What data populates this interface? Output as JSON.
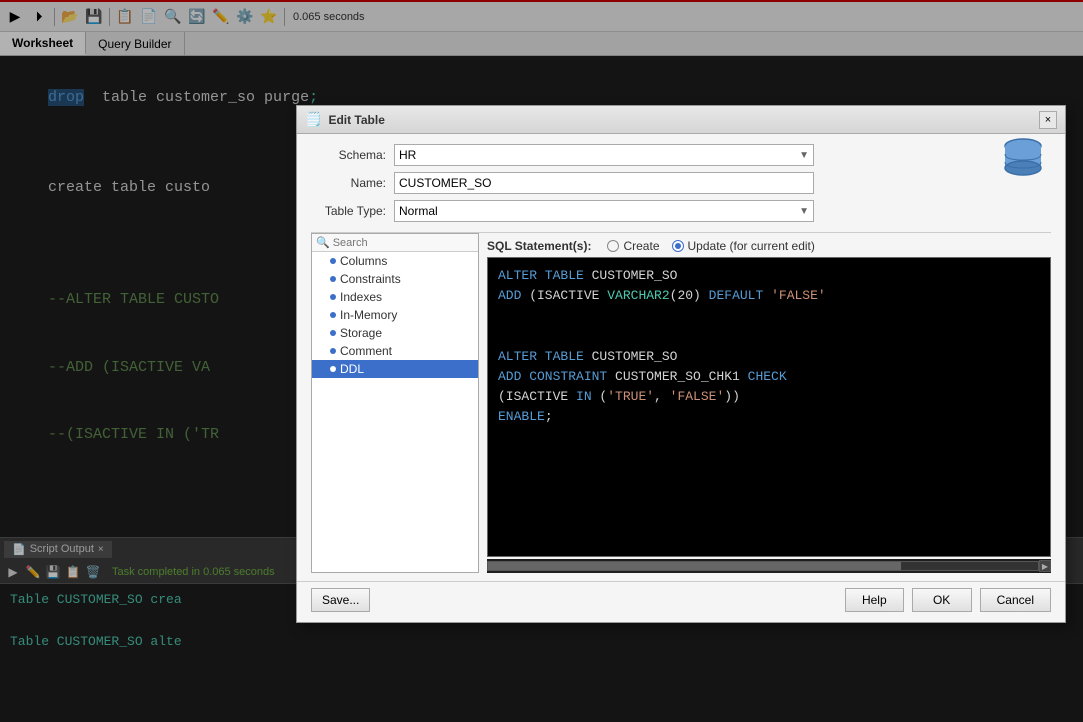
{
  "toolbar": {
    "timer": "0.065 seconds"
  },
  "tabs": [
    {
      "label": "Worksheet",
      "active": true
    },
    {
      "label": "Query Builder",
      "active": false
    }
  ],
  "editor": {
    "lines": [
      "drop  table customer_so purge;",
      "",
      "create table custo"
    ],
    "lines2": [
      "--ALTER TABLE CUSTO",
      "--ADD (ISACTIVE VA",
      "--(ISACTIVE IN ('TR"
    ]
  },
  "bottom_panel": {
    "tab_label": "Script Output",
    "status_text": "Task completed in 0.065 seconds",
    "output_lines": [
      "Table CUSTOMER_SO crea",
      "",
      "Table CUSTOMER_SO alte"
    ]
  },
  "dialog": {
    "title": "Edit Table",
    "close_label": "×",
    "schema_label": "Schema:",
    "schema_value": "HR",
    "name_label": "Name:",
    "name_value": "CUSTOMER_SO",
    "table_type_label": "Table Type:",
    "table_type_value": "Normal",
    "search_placeholder": "Search",
    "tree_items": [
      {
        "label": "Columns",
        "selected": false,
        "indent": true
      },
      {
        "label": "Constraints",
        "selected": false,
        "indent": true
      },
      {
        "label": "Indexes",
        "selected": false,
        "indent": true
      },
      {
        "label": "In-Memory",
        "selected": false,
        "indent": true
      },
      {
        "label": "Storage",
        "selected": false,
        "indent": true
      },
      {
        "label": "Comment",
        "selected": false,
        "indent": true
      },
      {
        "label": "DDL",
        "selected": true,
        "indent": true
      }
    ],
    "sql_label": "SQL Statement(s):",
    "radio_create": "Create",
    "radio_update": "Update (for current edit)",
    "sql_lines": [
      "ALTER TABLE CUSTOMER_SO",
      "ADD (ISACTIVE VARCHAR2(20) DEFAULT 'FALSE'",
      "",
      "",
      "ALTER TABLE CUSTOMER_SO",
      "ADD CONSTRAINT CUSTOMER_SO_CHK1 CHECK",
      "(ISACTIVE IN ('TRUE', 'FALSE'))",
      "ENABLE;"
    ],
    "save_label": "Save...",
    "help_label": "Help",
    "ok_label": "OK",
    "cancel_label": "Cancel"
  }
}
